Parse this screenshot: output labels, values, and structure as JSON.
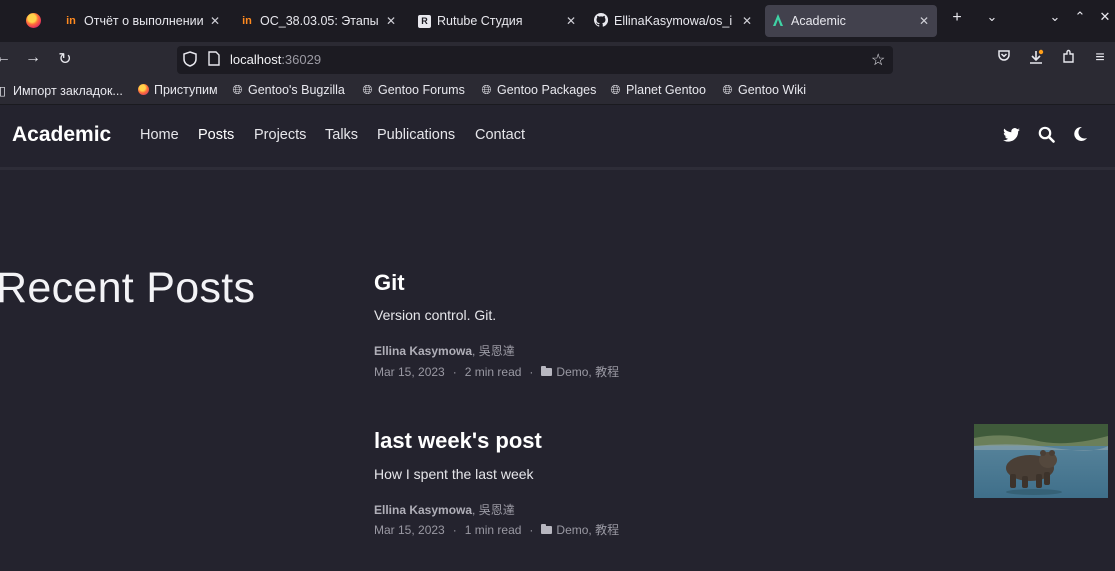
{
  "browser": {
    "tabs": [
      {
        "title": "Отчёт о выполнении",
        "favicon": "in-favicon",
        "active": false
      },
      {
        "title": "ОС_38.03.05: Этапы",
        "favicon": "in-favicon",
        "active": false
      },
      {
        "title": "Rutube Студия",
        "favicon": "rutube-favicon",
        "active": false
      },
      {
        "title": "EllinaKasymowa/os_i",
        "favicon": "github-icon",
        "active": false
      },
      {
        "title": "Academic",
        "favicon": "academic-favicon",
        "active": true
      }
    ],
    "url": {
      "host": "localhost",
      "port": ":36029"
    },
    "bookmarks": [
      {
        "label": "Импорт закладок...",
        "icon": "import-icon"
      },
      {
        "label": "Приступим",
        "icon": "firefox-icon"
      },
      {
        "label": "Gentoo's Bugzilla",
        "icon": "globe-icon"
      },
      {
        "label": "Gentoo Forums",
        "icon": "globe-icon"
      },
      {
        "label": "Gentoo Packages",
        "icon": "globe-icon"
      },
      {
        "label": "Planet Gentoo",
        "icon": "globe-icon"
      },
      {
        "label": "Gentoo Wiki",
        "icon": "globe-icon"
      }
    ]
  },
  "site": {
    "brand": "Academic",
    "menu": [
      "Home",
      "Posts",
      "Projects",
      "Talks",
      "Publications",
      "Contact"
    ],
    "active_menu": "Posts",
    "header_icons": [
      "twitter-icon",
      "search-icon",
      "moon-icon"
    ]
  },
  "section": {
    "title": "Recent Posts"
  },
  "posts": [
    {
      "title": "Git",
      "summary": "Version control. Git.",
      "author_main": "Ellina Kasymowa",
      "author_rest": ", 吳恩達",
      "date": "Mar 15, 2023",
      "read_time": "2 min read",
      "categories": "Demo, 教程",
      "has_thumbnail": false
    },
    {
      "title": "last week's post",
      "summary": "How I spent the last week",
      "author_main": "Ellina Kasymowa",
      "author_rest": ", 吳恩達",
      "date": "Mar 15, 2023",
      "read_time": "1 min read",
      "categories": "Demo, 教程",
      "has_thumbnail": true
    }
  ],
  "colors": {
    "background": "#24232e",
    "tabbar": "#1c1b22",
    "toolbar": "#2b2a33",
    "active_tab": "#42414d"
  }
}
